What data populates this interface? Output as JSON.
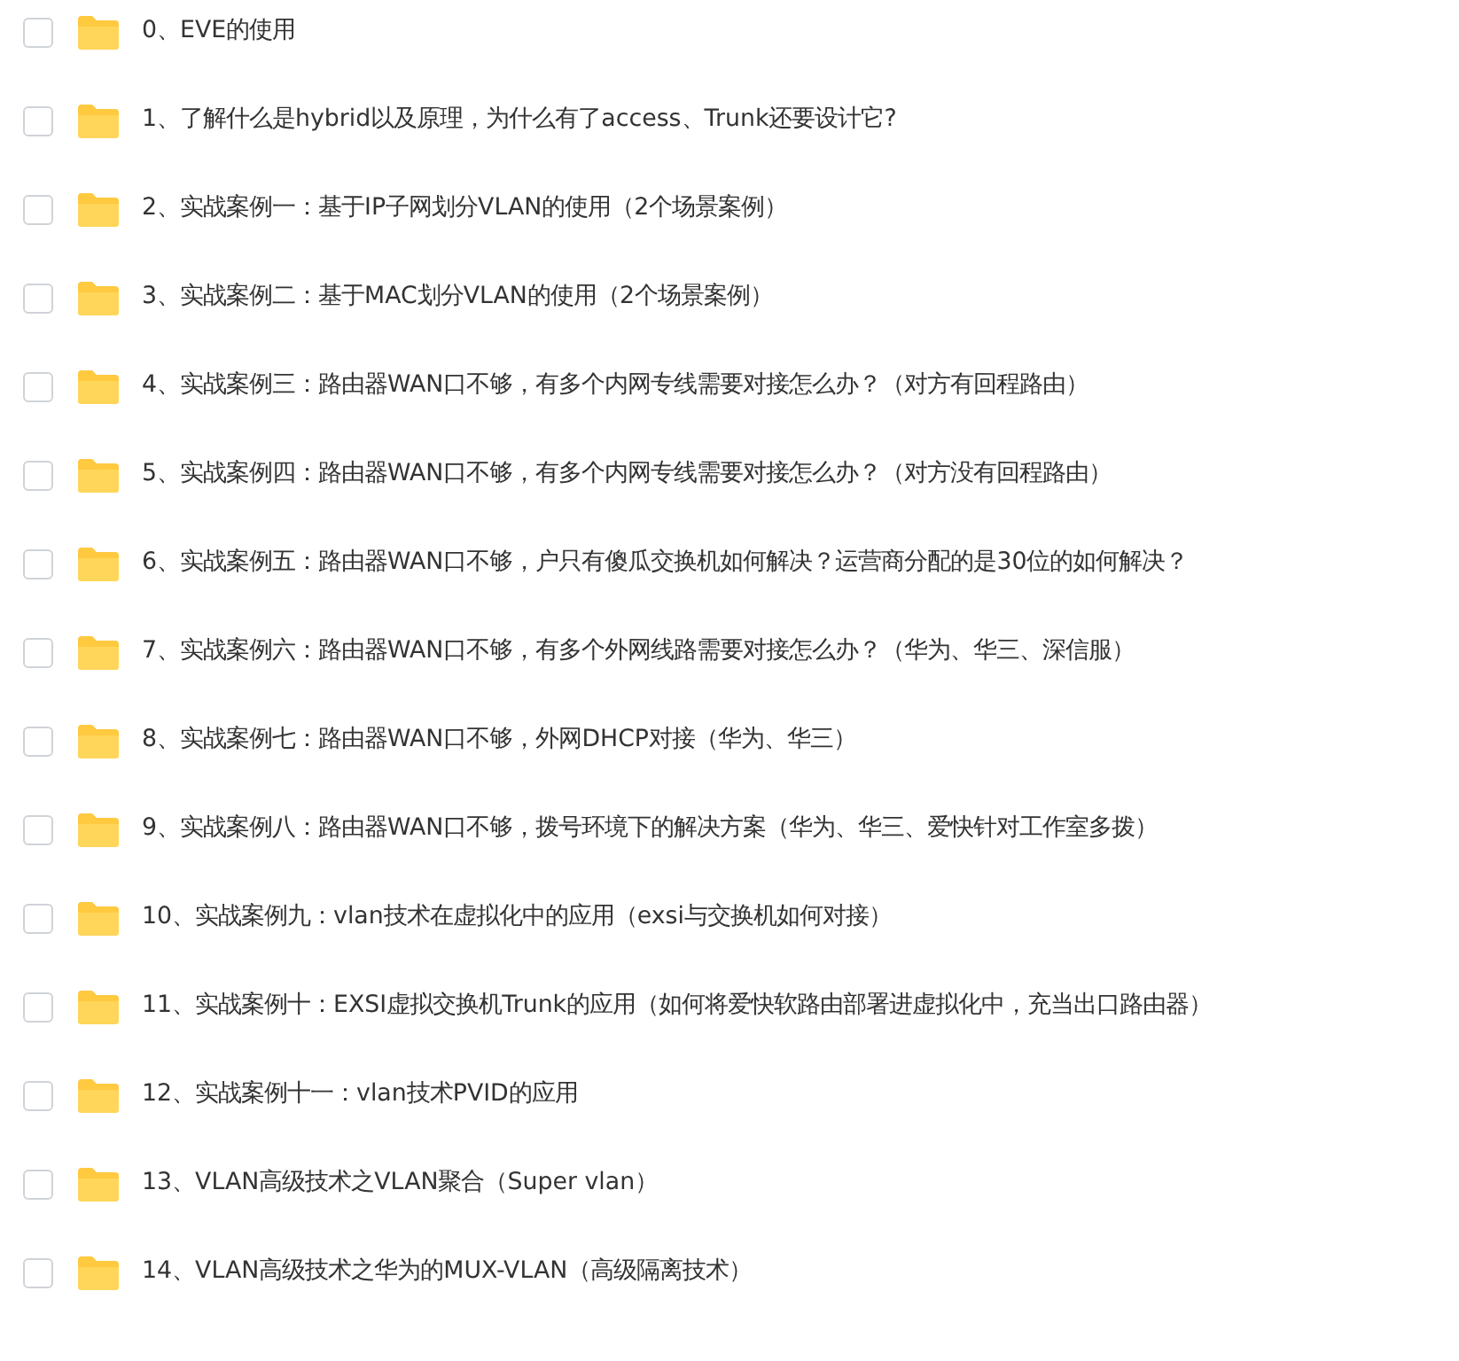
{
  "items": [
    {
      "label": "0、EVE的使用",
      "checked": false
    },
    {
      "label": "1、了解什么是hybrid以及原理，为什么有了access、Trunk还要设计它?",
      "checked": false
    },
    {
      "label": "2、实战案例一：基于IP子网划分VLAN的使用（2个场景案例）",
      "checked": false
    },
    {
      "label": "3、实战案例二：基于MAC划分VLAN的使用（2个场景案例）",
      "checked": false
    },
    {
      "label": "4、实战案例三：路由器WAN口不够，有多个内网专线需要对接怎么办？（对方有回程路由）",
      "checked": false
    },
    {
      "label": "5、实战案例四：路由器WAN口不够，有多个内网专线需要对接怎么办？（对方没有回程路由）",
      "checked": false
    },
    {
      "label": "6、实战案例五：路由器WAN口不够，户只有傻瓜交换机如何解决？运营商分配的是30位的如何解决？",
      "checked": false
    },
    {
      "label": "7、实战案例六：路由器WAN口不够，有多个外网线路需要对接怎么办？（华为、华三、深信服）",
      "checked": false
    },
    {
      "label": "8、实战案例七：路由器WAN口不够，外网DHCP对接（华为、华三）",
      "checked": false
    },
    {
      "label": "9、实战案例八：路由器WAN口不够，拨号环境下的解决方案（华为、华三、爱快针对工作室多拨）",
      "checked": false
    },
    {
      "label": "10、实战案例九：vlan技术在虚拟化中的应用（exsi与交换机如何对接）",
      "checked": false
    },
    {
      "label": "11、实战案例十：EXSI虚拟交换机Trunk的应用（如何将爱快软路由部署进虚拟化中，充当出口路由器）",
      "checked": false
    },
    {
      "label": "12、实战案例十一：vlan技术PVID的应用",
      "checked": false
    },
    {
      "label": "13、VLAN高级技术之VLAN聚合（Super vlan）",
      "checked": false
    },
    {
      "label": "14、VLAN高级技术之华为的MUX-VLAN（高级隔离技术）",
      "checked": false
    }
  ]
}
